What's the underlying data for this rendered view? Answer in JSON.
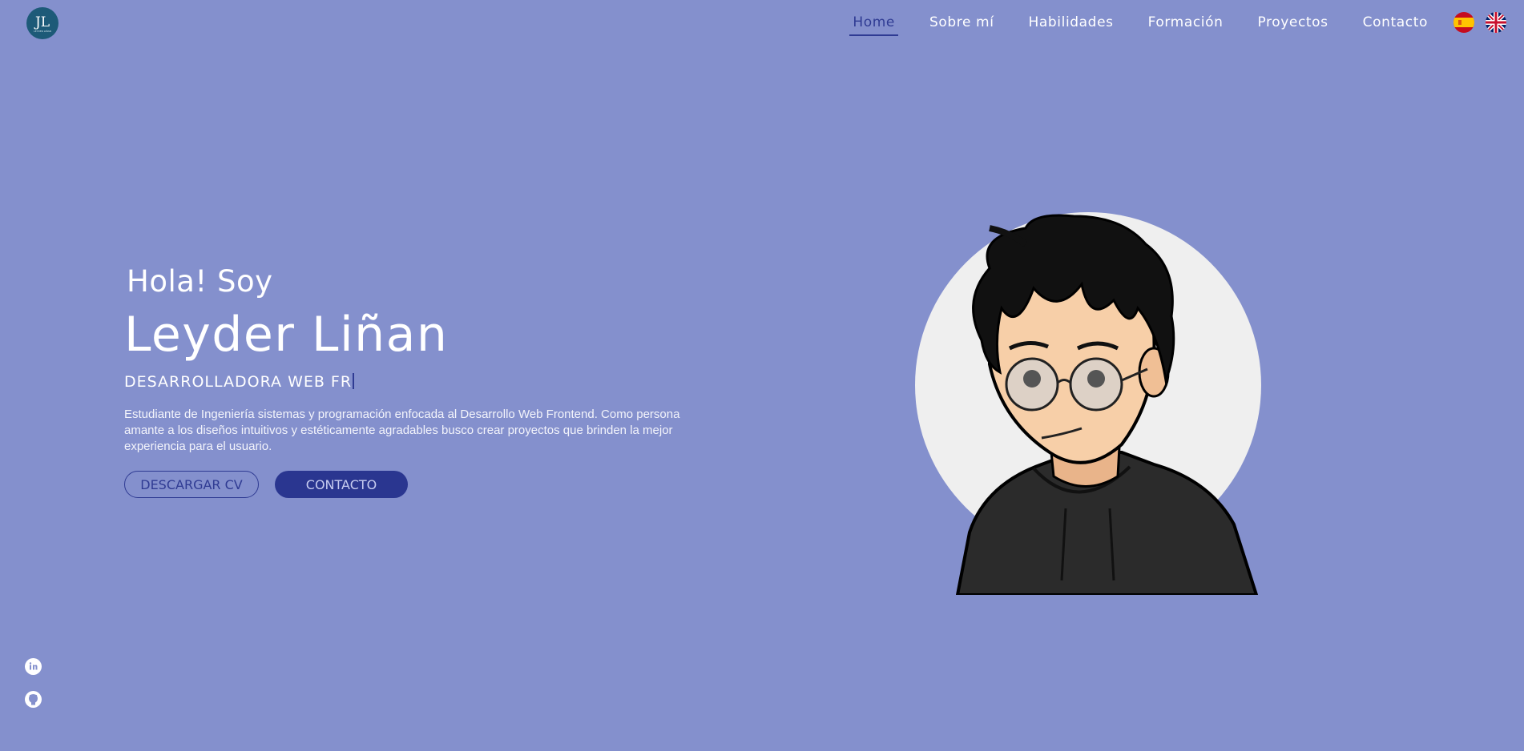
{
  "logo": {
    "monogram": "JL",
    "tagline": "LEYDER LIÑAN"
  },
  "nav": {
    "items": [
      {
        "label": "Home",
        "active": true
      },
      {
        "label": "Sobre mí",
        "active": false
      },
      {
        "label": "Habilidades",
        "active": false
      },
      {
        "label": "Formación",
        "active": false
      },
      {
        "label": "Proyectos",
        "active": false
      },
      {
        "label": "Contacto",
        "active": false
      }
    ]
  },
  "languages": {
    "es": "spain-flag-icon",
    "en": "uk-flag-icon"
  },
  "hero": {
    "greeting": "Hola! Soy",
    "name": "Leyder Liñan",
    "role": "DESARROLLADORA WEB FR",
    "description": "Estudiante de Ingeniería sistemas y programación enfocada al Desarrollo Web Frontend. Como persona amante a los diseños intuitivos y estéticamente agradables busco crear proyectos que brinden la mejor experiencia para el usuario.",
    "download_cv_label": "DESCARGAR CV",
    "contact_label": "CONTACTO"
  },
  "social": {
    "linkedin": "linkedin-icon",
    "github": "github-icon"
  },
  "colors": {
    "background": "#8490cd",
    "accent": "#2f3b93",
    "button_fill": "#2a3690",
    "avatar_circle": "#efefef"
  }
}
